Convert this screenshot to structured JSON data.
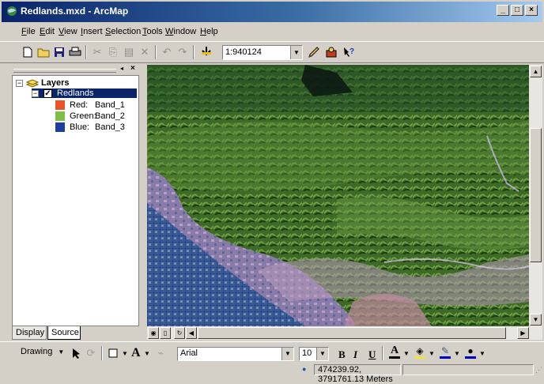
{
  "window": {
    "title": "Redlands.mxd - ArcMap"
  },
  "menu": [
    {
      "label": "File",
      "u": "F",
      "rest": "ile"
    },
    {
      "label": "Edit",
      "u": "E",
      "rest": "dit"
    },
    {
      "label": "View",
      "u": "V",
      "rest": "iew"
    },
    {
      "label": "Insert",
      "u": "I",
      "rest": "nsert"
    },
    {
      "label": "Selection",
      "u": "S",
      "rest": "election"
    },
    {
      "label": "Tools",
      "u": "T",
      "rest": "ools"
    },
    {
      "label": "Window",
      "u": "W",
      "rest": "indow"
    },
    {
      "label": "Help",
      "u": "H",
      "rest": "elp"
    }
  ],
  "toolbar": {
    "scale": "1:940124"
  },
  "toc": {
    "root_label": "Layers",
    "layer_label": "Redlands",
    "bands": [
      {
        "channel": "Red:",
        "band": "Band_1",
        "color": "#e8542c"
      },
      {
        "channel": "Green:",
        "band": "Band_2",
        "color": "#7cc04a"
      },
      {
        "channel": "Blue:",
        "band": "Band_3",
        "color": "#1c3f9e"
      }
    ],
    "tabs": {
      "display": "Display",
      "source": "Source"
    }
  },
  "drawing": {
    "label": "Drawing",
    "font": "Arial",
    "size": "10",
    "bold": "B",
    "italic": "I",
    "underline": "U",
    "text_tool": "A"
  },
  "status": {
    "coords": "474239.92, 3791761.13 Meters"
  },
  "colors": {
    "title_start": "#0a246a",
    "title_end": "#a6caf0",
    "selection": "#0a246a"
  }
}
